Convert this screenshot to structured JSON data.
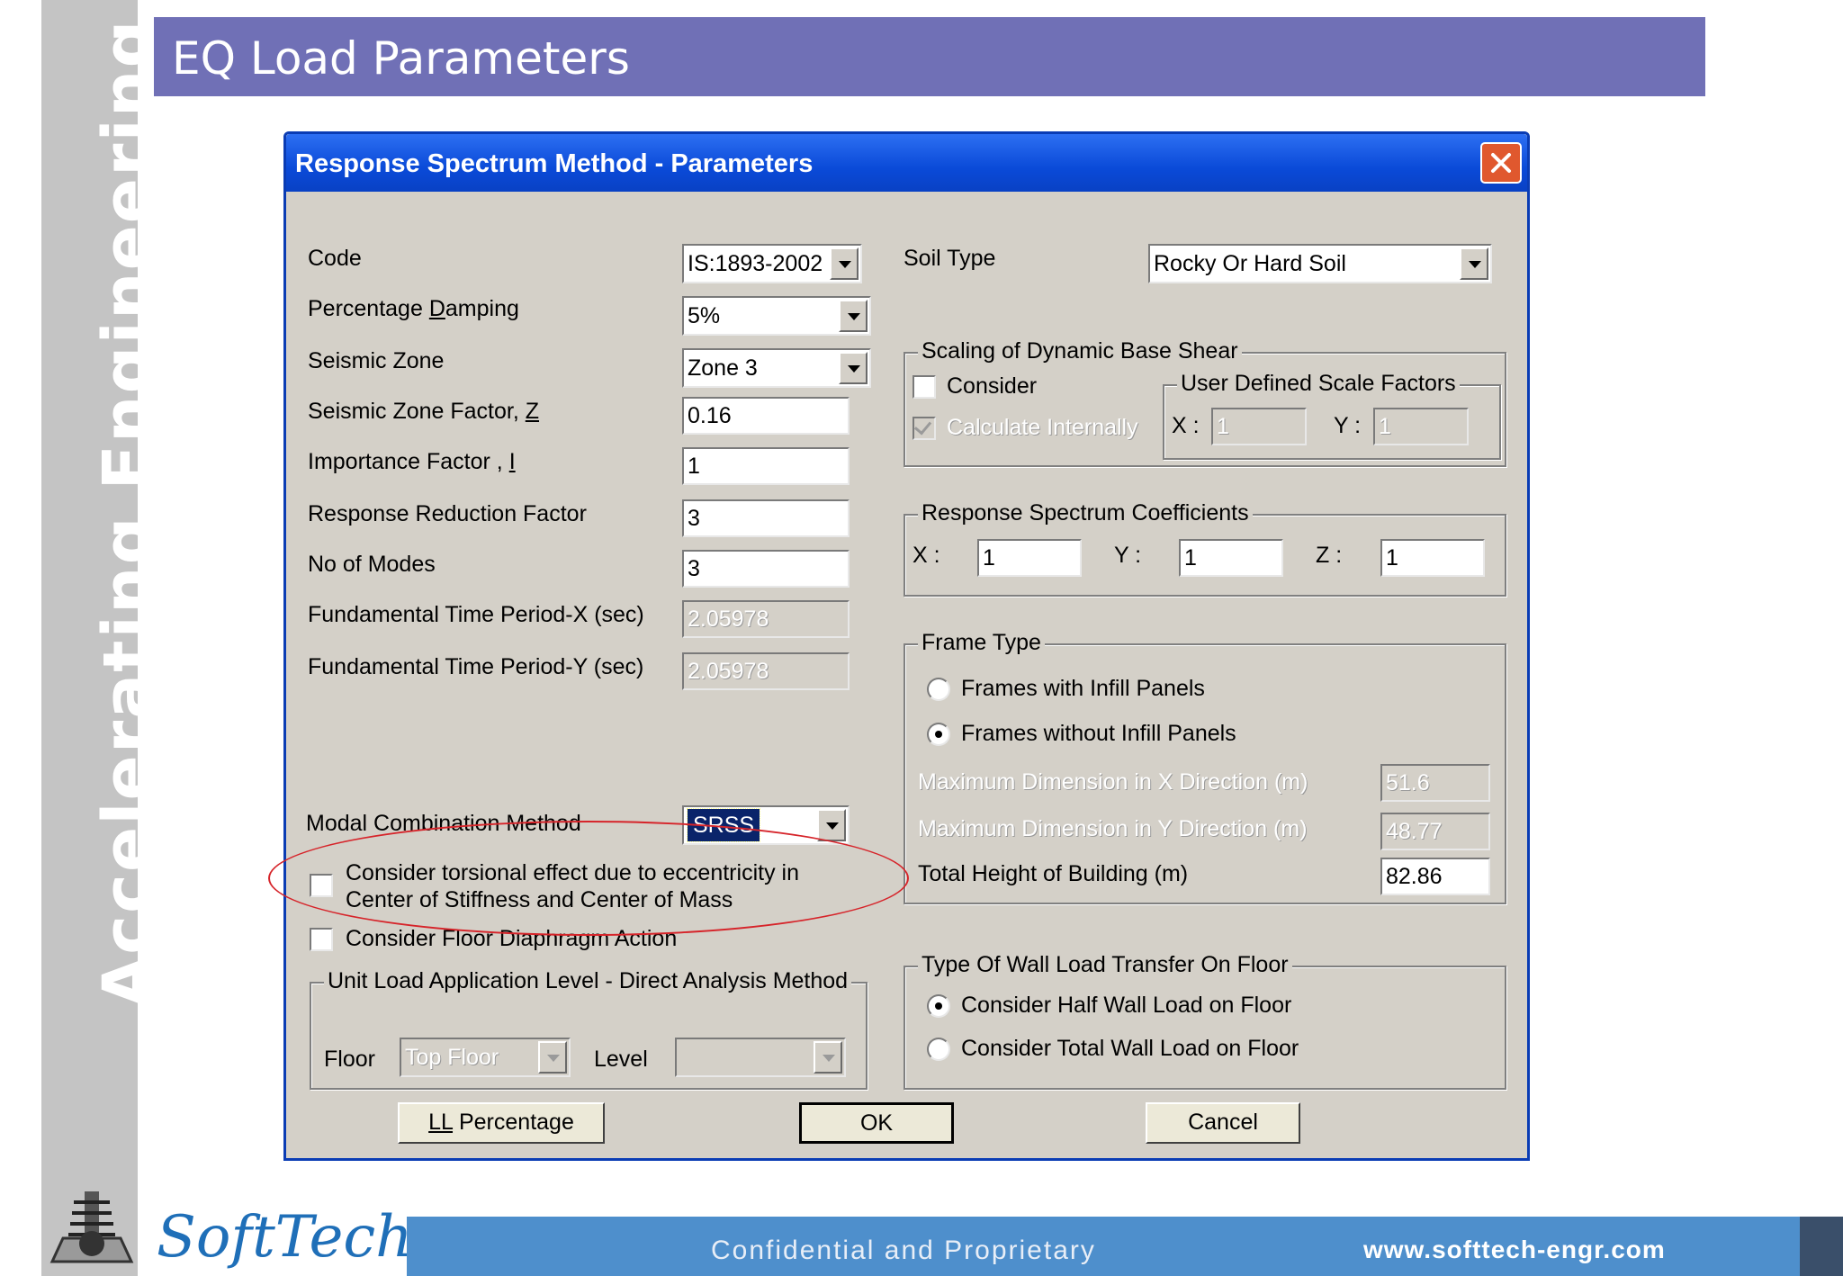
{
  "slide": {
    "title": "EQ Load Parameters",
    "side_text": "Accelerating Engineering Processes",
    "footer_text": "Confidential and Proprietary",
    "footer_url": "www.softtech-engr.com",
    "logo_text": "SoftTech"
  },
  "dialog": {
    "title": "Response Spectrum Method - Parameters",
    "left": {
      "code_label": "Code",
      "code_value": "IS:1893-2002",
      "damping_label_pre": "Percentage ",
      "damping_label_key": "D",
      "damping_label_post": "amping",
      "damping_value": "5%",
      "zone_label": "Seismic Zone",
      "zone_value": "Zone 3",
      "zone_factor_label_pre": "Seismic Zone Factor, ",
      "zone_factor_label_key": "Z",
      "zone_factor_value": "0.16",
      "importance_label_pre": "Importance Factor , ",
      "importance_label_key": "I",
      "importance_value": "1",
      "reduction_label": "Response Reduction Factor",
      "reduction_value": "3",
      "modes_label": "No of Modes",
      "modes_value": "3",
      "period_x_label": "Fundamental Time Period-X (sec)",
      "period_x_value": "2.05978",
      "period_y_label": "Fundamental Time Period-Y (sec)",
      "period_y_value": "2.05978",
      "modal_label": "Modal Combination Method",
      "modal_value": "SRSS",
      "torsion_line1": "Consider torsional effect due to eccentricity in",
      "torsion_line2": "Center of Stiffness and Center of Mass",
      "diaphragm_label": "Consider Floor Diaphragm Action",
      "unit_load_group": "Unit Load Application Level - Direct Analysis Method",
      "floor_label": "Floor",
      "floor_value": "Top Floor",
      "level_label": "Level",
      "level_value": ""
    },
    "right": {
      "soil_label": "Soil Type",
      "soil_value": "Rocky Or Hard Soil",
      "scaling_group": "Scaling of Dynamic Base Shear",
      "consider_label": "Consider",
      "calc_label": "Calculate Internally",
      "user_scale_group": "User Defined Scale Factors",
      "scale_x_label": "X :",
      "scale_x_value": "1",
      "scale_y_label": "Y :",
      "scale_y_value": "1",
      "rsc_group": "Response Spectrum Coefficients",
      "rsc_x_label": "X :",
      "rsc_x_value": "1",
      "rsc_y_label": "Y :",
      "rsc_y_value": "1",
      "rsc_z_label": "Z :",
      "rsc_z_value": "1",
      "frame_group": "Frame Type",
      "frame_infill": "Frames with Infill Panels",
      "frame_no_infill": "Frames without Infill Panels",
      "max_x_label": "Maximum Dimension in X Direction  (m)",
      "max_x_value": "51.6",
      "max_y_label": "Maximum Dimension in Y Direction  (m)",
      "max_y_value": "48.77",
      "height_label": "Total Height of Building  (m)",
      "height_value": "82.86",
      "wall_group": "Type Of Wall Load Transfer On Floor",
      "wall_half": "Consider Half Wall  Load on Floor",
      "wall_total": "Consider Total  Wall  Load on Floor"
    },
    "buttons": {
      "ll_pre": "",
      "ll_key": "LL",
      "ll_post": " Percentage",
      "ok": "OK",
      "cancel": "Cancel"
    }
  },
  "colors": {
    "title_bar": "#7070b6",
    "footer_bar": "#4e8fcc",
    "dialog_bg": "#d4d0c8",
    "xp_title": "#0a4ad8",
    "highlight_ellipse": "#d6242a"
  }
}
